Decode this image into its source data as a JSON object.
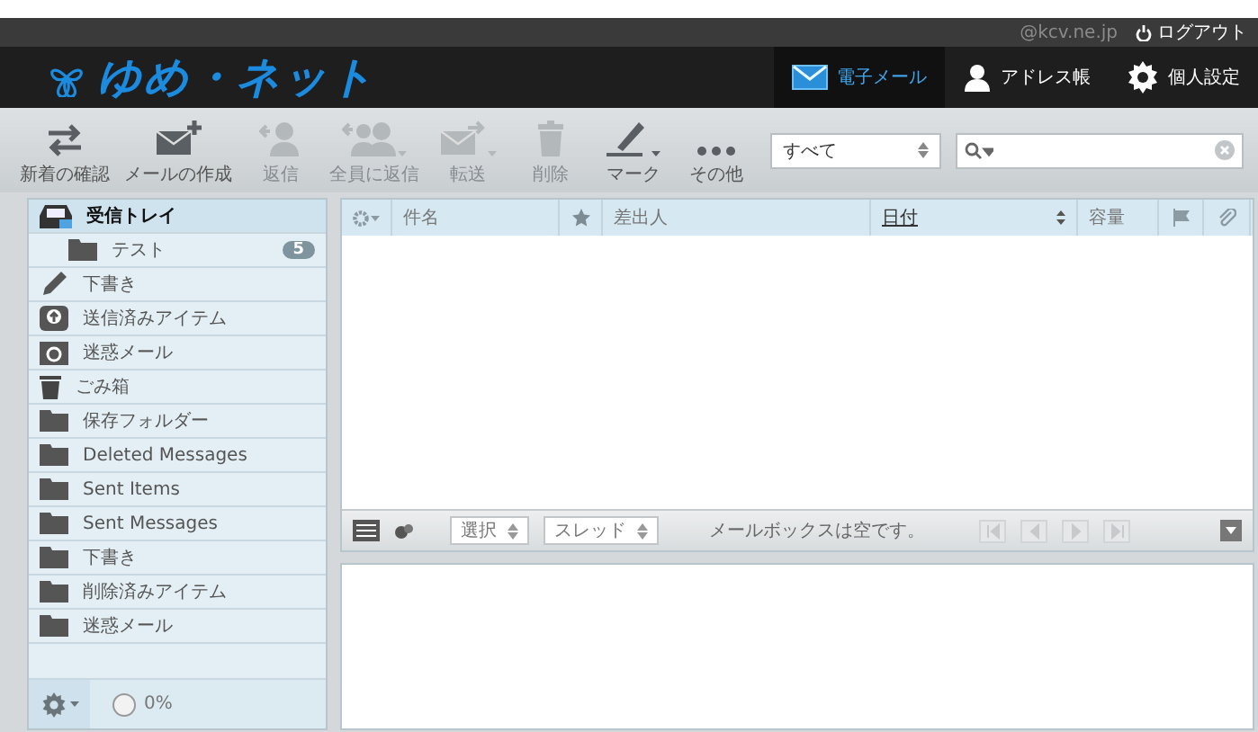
{
  "account": {
    "user": "@kcv.ne.jp",
    "logout": "ログアウト"
  },
  "logo": {
    "text": "ゆめ・ネット"
  },
  "nav": [
    {
      "label": "電子メール",
      "selected": true
    },
    {
      "label": "アドレス帳",
      "selected": false
    },
    {
      "label": "個人設定",
      "selected": false
    }
  ],
  "toolbar": [
    {
      "label": "新着の確認",
      "disabled": false,
      "menu": false
    },
    {
      "label": "メールの作成",
      "disabled": false,
      "menu": false
    },
    {
      "label": "返信",
      "disabled": true,
      "menu": false
    },
    {
      "label": "全員に返信",
      "disabled": true,
      "menu": true
    },
    {
      "label": "転送",
      "disabled": true,
      "menu": true
    },
    {
      "label": "削除",
      "disabled": true,
      "menu": false
    },
    {
      "label": "マーク",
      "disabled": false,
      "menu": true
    },
    {
      "label": "その他",
      "disabled": false,
      "menu": false
    }
  ],
  "filter": {
    "value": "すべて"
  },
  "folders": [
    {
      "name": "受信トレイ",
      "kind": "inbox",
      "selected": true,
      "children": [
        {
          "name": "テスト",
          "kind": "folder",
          "selected": false,
          "count": "5"
        }
      ]
    },
    {
      "name": "下書き",
      "kind": "drafts",
      "selected": false
    },
    {
      "name": "送信済みアイテム",
      "kind": "sent",
      "selected": false
    },
    {
      "name": "迷惑メール",
      "kind": "junk",
      "selected": false
    },
    {
      "name": "ごみ箱",
      "kind": "trash",
      "selected": false
    },
    {
      "name": "保存フォルダー",
      "kind": "folder",
      "selected": false
    },
    {
      "name": "Deleted Messages",
      "kind": "folder",
      "selected": false
    },
    {
      "name": "Sent Items",
      "kind": "folder",
      "selected": false
    },
    {
      "name": "Sent Messages",
      "kind": "folder",
      "selected": false
    },
    {
      "name": "下書き",
      "kind": "folder",
      "selected": false
    },
    {
      "name": "削除済みアイテム",
      "kind": "folder",
      "selected": false
    },
    {
      "name": "迷惑メール",
      "kind": "folder",
      "selected": false
    }
  ],
  "quota": {
    "text": "0%"
  },
  "table": {
    "columns": [
      {
        "label": "件名",
        "kind": "subject",
        "sorted": false
      },
      {
        "kind": "flagged"
      },
      {
        "label": "差出人",
        "kind": "from",
        "sorted": false
      },
      {
        "label": "日付",
        "kind": "date",
        "sorted": true
      },
      {
        "label": "容量",
        "kind": "size",
        "sorted": false
      },
      {
        "kind": "flag"
      },
      {
        "kind": "attach"
      }
    ]
  },
  "list_footer": {
    "select": "選択",
    "threads": "スレッド",
    "status": "メールボックスは空です。"
  }
}
